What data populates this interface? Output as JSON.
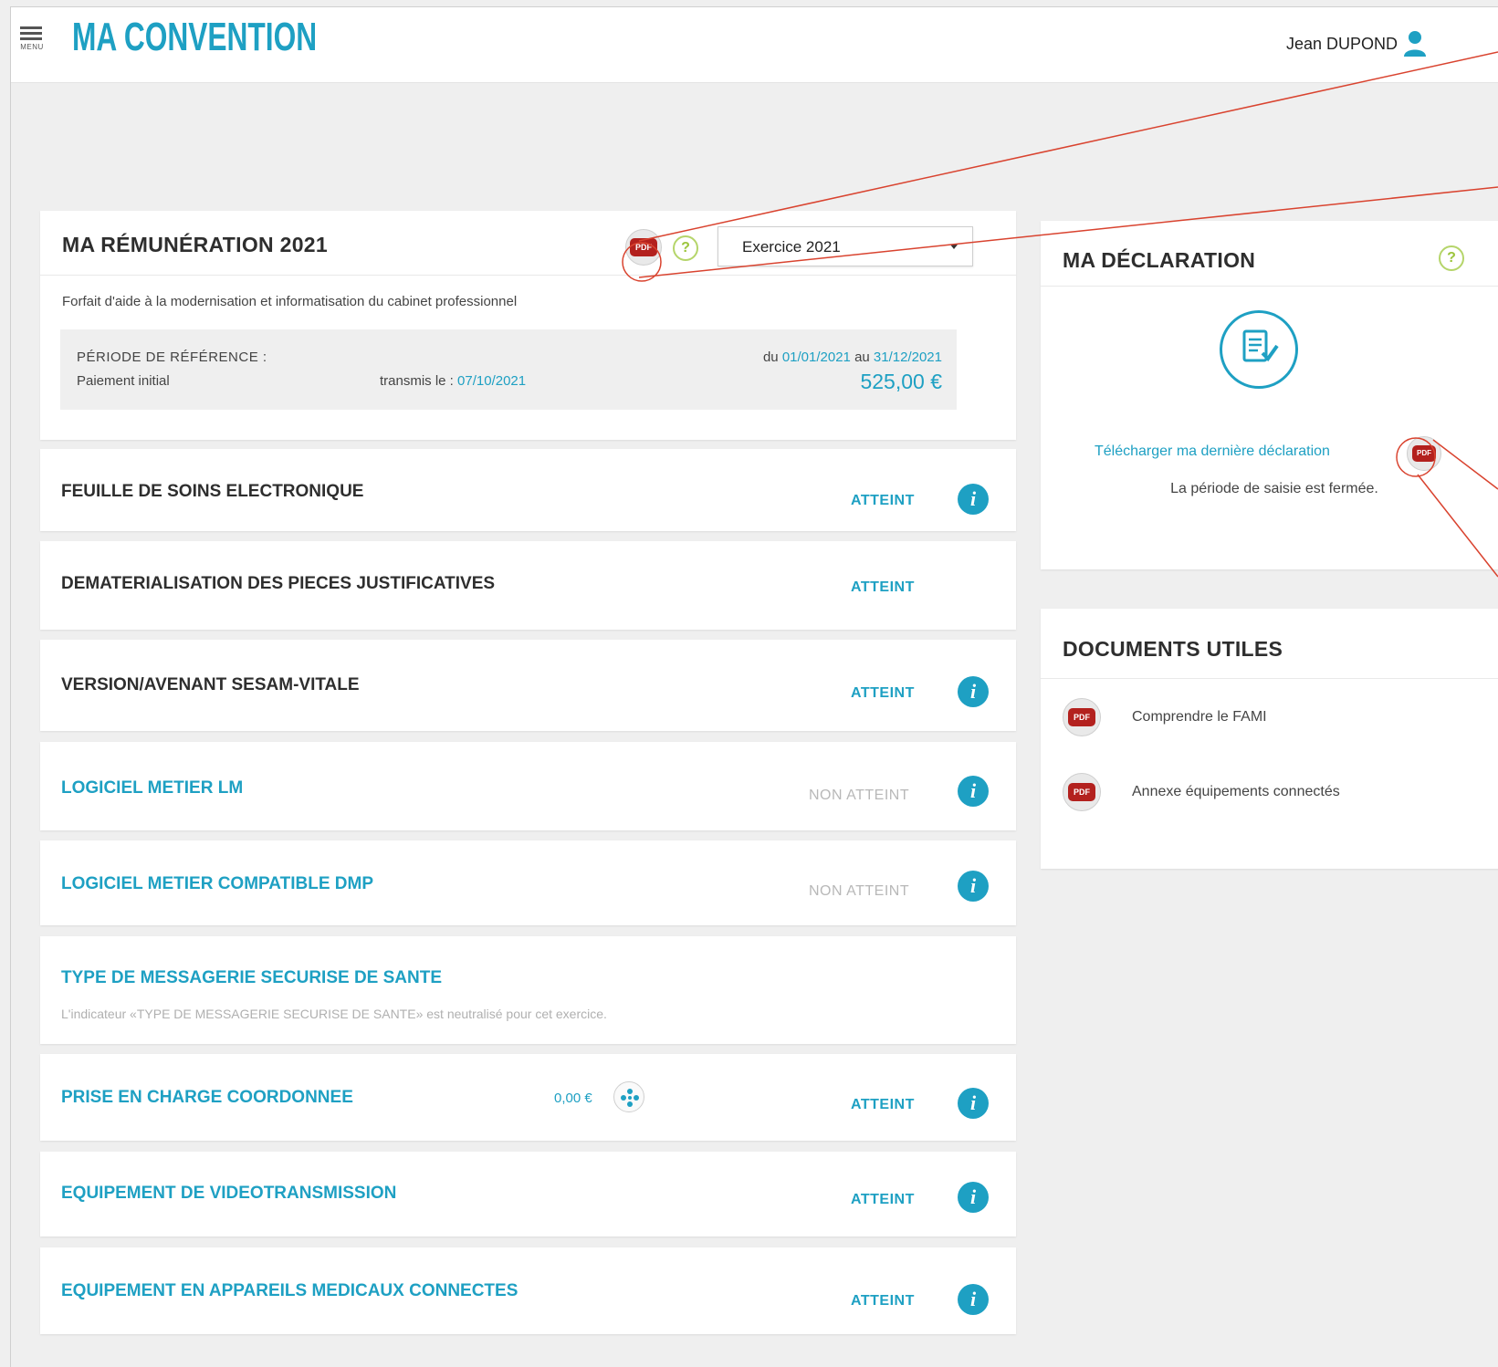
{
  "header": {
    "menu_label": "MENU",
    "app_title": "MA CONVENTION",
    "user_name": "Jean DUPOND"
  },
  "remuneration": {
    "title": "MA RÉMUNÉRATION 2021",
    "pdf_label": "PDF",
    "help_label": "?",
    "exercise_select": "Exercice 2021",
    "description": "Forfait d'aide à la modernisation et informatisation du cabinet professionnel",
    "period_label": "PÉRIODE DE RÉFÉRENCE :",
    "period_from_prefix": "du",
    "period_from": "01/01/2021",
    "period_to_prefix": "au",
    "period_to": "31/12/2021",
    "payment_label": "Paiement initial",
    "transmitted_prefix": "transmis le :",
    "transmitted_date": "07/10/2021",
    "amount": "525,00 €"
  },
  "indicators": [
    {
      "label": "FEUILLE DE SOINS ELECTRONIQUE",
      "status": "ATTEINT"
    },
    {
      "label": "DEMATERIALISATION DES PIECES JUSTIFICATIVES",
      "status": "ATTEINT"
    },
    {
      "label": "VERSION/AVENANT SESAM-VITALE",
      "status": "ATTEINT"
    },
    {
      "label": "LOGICIEL METIER LM",
      "status": "NON ATTEINT"
    },
    {
      "label": "LOGICIEL METIER COMPATIBLE DMP",
      "status": "NON ATTEINT"
    },
    {
      "label": "TYPE DE MESSAGERIE SECURISE DE SANTE",
      "note": "L'indicateur «TYPE DE MESSAGERIE SECURISE DE SANTE» est neutralisé pour cet exercice."
    },
    {
      "label": "PRISE EN CHARGE COORDONNEE",
      "amount": "0,00 €",
      "status": "ATTEINT"
    },
    {
      "label": "EQUIPEMENT DE VIDEOTRANSMISSION",
      "status": "ATTEINT"
    },
    {
      "label": "EQUIPEMENT EN APPAREILS MEDICAUX CONNECTES",
      "status": "ATTEINT"
    }
  ],
  "declaration": {
    "title": "MA DÉCLARATION",
    "help_label": "?",
    "download_link": "Télécharger ma dernière déclaration",
    "pdf_label": "PDF",
    "status_text": "La période de saisie est fermée."
  },
  "documents": {
    "title": "DOCUMENTS UTILES",
    "items": [
      {
        "label": "Comprendre le FAMI",
        "pdf_label": "PDF"
      },
      {
        "label": "Annexe équipements connectés",
        "pdf_label": "PDF"
      }
    ]
  },
  "colors": {
    "brand": "#1ea0c3",
    "pdf_red": "#b3211e",
    "help_green": "#9cc53c",
    "annotation": "#d9432f"
  }
}
